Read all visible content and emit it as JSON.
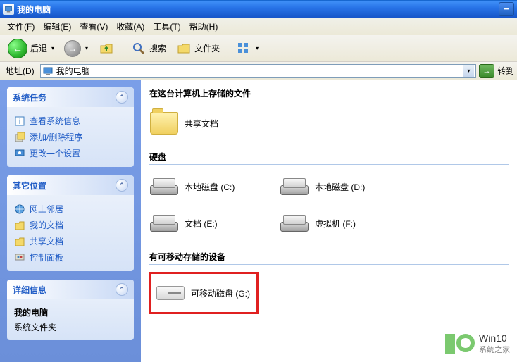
{
  "titlebar": {
    "title": "我的电脑"
  },
  "menu": {
    "file": "文件(F)",
    "edit": "编辑(E)",
    "view": "查看(V)",
    "favorites": "收藏(A)",
    "tools": "工具(T)",
    "help": "帮助(H)"
  },
  "toolbar": {
    "back": "后退",
    "search": "搜索",
    "folders": "文件夹"
  },
  "address": {
    "label": "地址(D)",
    "value": "我的电脑",
    "go": "转到"
  },
  "sidebar": {
    "tasks": {
      "title": "系统任务",
      "items": [
        "查看系统信息",
        "添加/删除程序",
        "更改一个设置"
      ]
    },
    "other": {
      "title": "其它位置",
      "items": [
        "网上邻居",
        "我的文档",
        "共享文档",
        "控制面板"
      ]
    },
    "details": {
      "title": "详细信息",
      "name": "我的电脑",
      "type": "系统文件夹"
    }
  },
  "sections": {
    "files": {
      "title": "在这台计算机上存储的文件",
      "items": [
        "共享文档"
      ]
    },
    "hdd": {
      "title": "硬盘",
      "items": [
        "本地磁盘 (C:)",
        "本地磁盘 (D:)",
        "文档 (E:)",
        "虚拟机 (F:)"
      ]
    },
    "removable": {
      "title": "有可移动存储的设备",
      "items": [
        "可移动磁盘 (G:)"
      ]
    }
  },
  "watermark": {
    "l1": "Win10",
    "l2": "系统之家"
  }
}
